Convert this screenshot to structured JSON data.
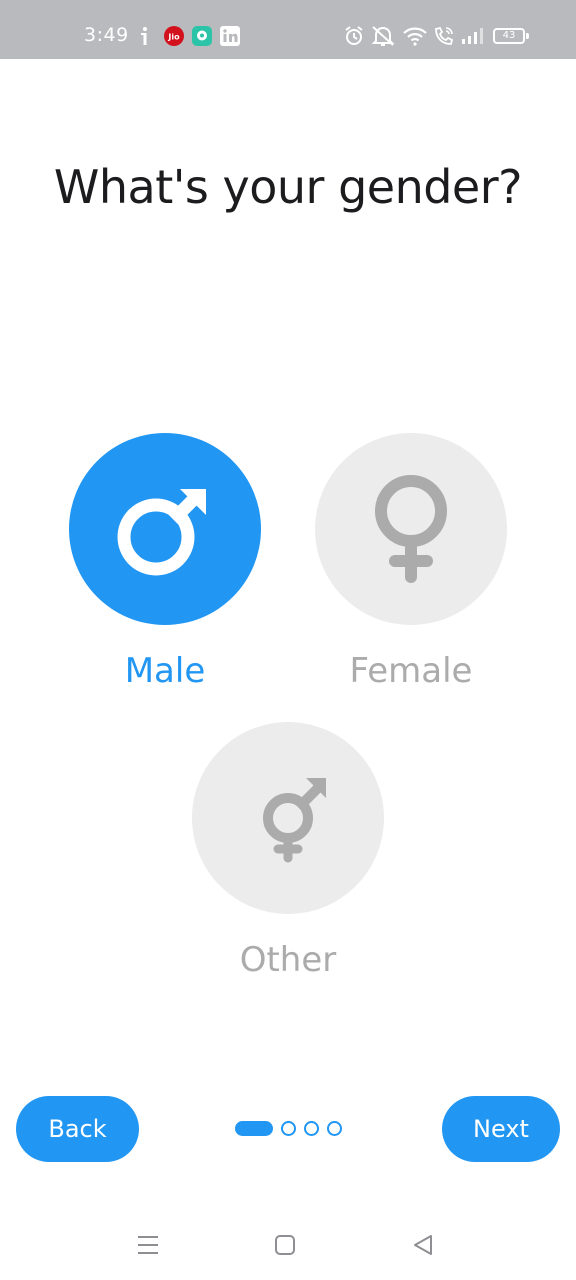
{
  "colors": {
    "accent": "#2196f3",
    "inactive_circle": "#ececec",
    "inactive_symbol": "#ababab",
    "title": "#1c1c1e",
    "status_bar": "#b9babd"
  },
  "status_bar": {
    "time": "3:49",
    "battery": "43",
    "left_icons": [
      "info-icon",
      "jio-app-icon",
      "chat-app-icon",
      "linkedin-icon"
    ],
    "right_icons": [
      "alarm-icon",
      "mute-icon",
      "wifi-icon",
      "wifi-calling-icon",
      "signal-icon",
      "battery-icon"
    ]
  },
  "page": {
    "title": "What's your gender?"
  },
  "options": [
    {
      "label": "Male",
      "icon": "male-symbol-icon",
      "selected": true
    },
    {
      "label": "Female",
      "icon": "female-symbol-icon",
      "selected": false
    },
    {
      "label": "Other",
      "icon": "transgender-symbol-icon",
      "selected": false
    }
  ],
  "footer": {
    "back_label": "Back",
    "next_label": "Next",
    "pager": {
      "total": 4,
      "current": 1
    }
  },
  "system_nav": [
    "menu-icon",
    "home-icon",
    "back-triangle-icon"
  ]
}
